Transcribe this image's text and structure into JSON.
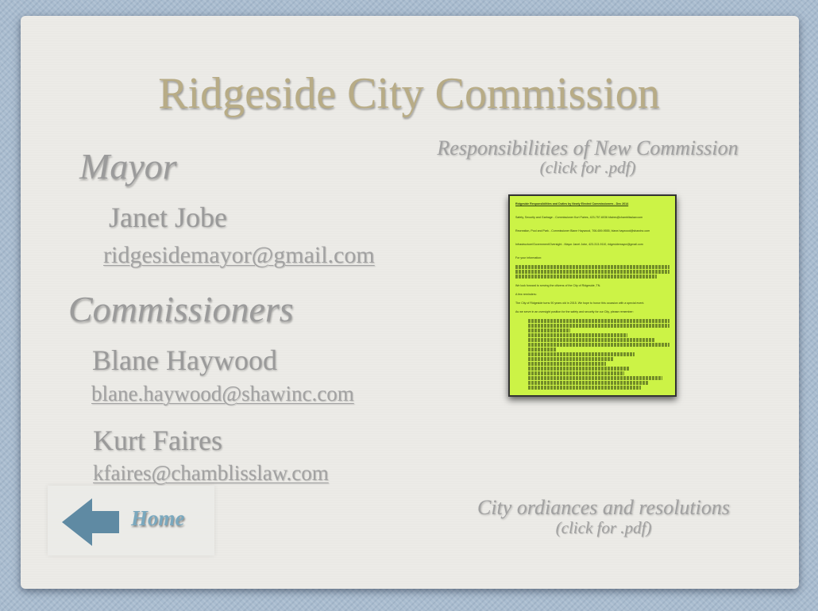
{
  "title": "Ridgeside City Commission",
  "mayor": {
    "heading": "Mayor",
    "name": "Janet Jobe",
    "email": "ridgesidemayor@gmail.com"
  },
  "commissioners": {
    "heading": "Commissioners",
    "members": [
      {
        "name": "Blane Haywood",
        "email": "blane.haywood@shawinc.com"
      },
      {
        "name": "Kurt Faires",
        "email": "kfaires@chamblisslaw.com"
      }
    ]
  },
  "responsibilities_link": {
    "caption": "Responsibilities of New Commission",
    "sub": "(click for .pdf)"
  },
  "document": {
    "lines": [
      "Ridgeside Responsibilities and Duties by Newly Elected Commissioners - Dec 2014",
      "Safety, Security and Garbage - Commissioner Kurt Faires, 423-757-6036 kfaires@chamblisslaw.com",
      "Recreation, Pool and Park - Commissioner Blane Haywood, 706-659-9555, blane.haywood@shawinc.com",
      "Infrastructure/Government/Oversight - Mayor Janet Jobe, 423-313-9110, ridgesidemayor@gmail.com",
      "For your information:",
      "We look forward to serving the citizens of the City of Ridgeside, TN.",
      "A few reminders:",
      "The City of Ridgeside turns 90 years old in 2015. We hope to honor this occasion with a special event.",
      "As we serve in an oversight position for the safety and security for our City, please remember:"
    ]
  },
  "ordinances_link": {
    "caption": "City ordiances and resolutions",
    "sub": "(click for .pdf)"
  },
  "home": {
    "label": "Home",
    "arrow_color": "#5f8aa3"
  },
  "colors": {
    "title": "#b8ac86",
    "document_background": "#ccf346",
    "slide_background": "#ecebe7",
    "frame_background": "#a9bccf"
  }
}
